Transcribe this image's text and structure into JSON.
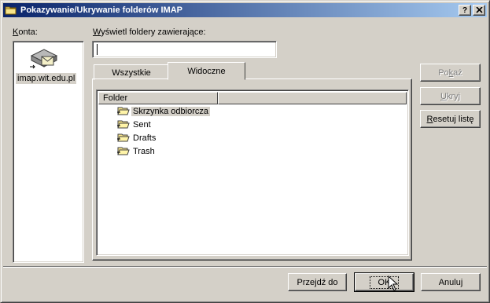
{
  "window": {
    "title": "Pokazywanie/Ukrywanie folderów IMAP",
    "help_button": "?",
    "close_button": "X"
  },
  "accounts": {
    "label_accel": "K",
    "label_rest": "onta:",
    "items": [
      {
        "label": "imap.wit.edu.pl",
        "icon": "mail-server-icon"
      }
    ]
  },
  "filter": {
    "label_accel": "W",
    "label_rest": "yświetl foldery zawierające:",
    "value": "",
    "placeholder": ""
  },
  "tabs": [
    {
      "label": "Wszystkie",
      "active": false
    },
    {
      "label": "Widoczne",
      "active": true
    }
  ],
  "folder_list": {
    "column_header": "Folder",
    "items": [
      {
        "label": "Skrzynka odbiorcza",
        "icon": "subscribed-folder-icon",
        "selected": true
      },
      {
        "label": "Sent",
        "icon": "subscribed-folder-icon",
        "selected": false
      },
      {
        "label": "Drafts",
        "icon": "subscribed-folder-icon",
        "selected": false
      },
      {
        "label": "Trash",
        "icon": "subscribed-folder-icon",
        "selected": false
      }
    ]
  },
  "side_buttons": {
    "show": {
      "pre": "Po",
      "accel": "k",
      "post": "aż",
      "enabled": false
    },
    "hide": {
      "pre": "",
      "accel": "U",
      "post": "kryj",
      "enabled": false
    },
    "reset": {
      "pre": "",
      "accel": "R",
      "post": "esetuj listę",
      "enabled": true
    }
  },
  "bottom_buttons": {
    "goto": {
      "pre": "Prze",
      "accel": "j",
      "post": "dź do"
    },
    "ok": "OK",
    "cancel": "Anuluj"
  },
  "colors": {
    "title_gradient_start": "#0a246a",
    "title_gradient_end": "#a6caf0",
    "face": "#d4d0c8"
  }
}
